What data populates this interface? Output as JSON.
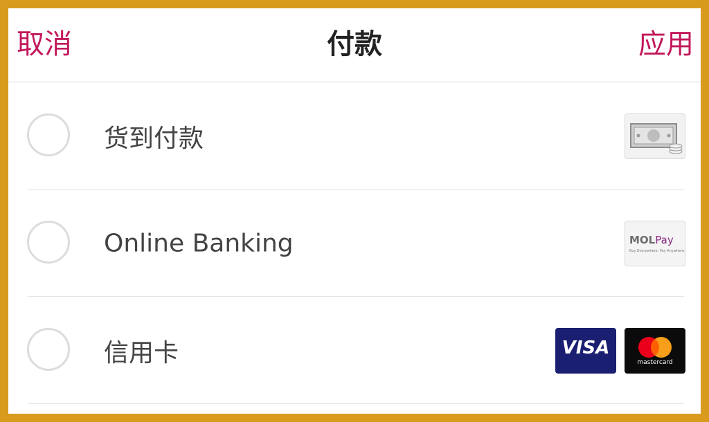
{
  "header": {
    "cancel_label": "取消",
    "title": "付款",
    "apply_label": "应用"
  },
  "payment_options": [
    {
      "label": "货到付款",
      "icon": "cash-icon",
      "selected": false
    },
    {
      "label": "Online Banking",
      "icon": "molpay-logo",
      "selected": false
    },
    {
      "label": "信用卡",
      "icon": [
        "visa-logo",
        "mastercard-logo"
      ],
      "selected": false
    }
  ],
  "logos": {
    "molpay_brand_mol": "MOL",
    "molpay_brand_pay": "Pay",
    "molpay_tagline": "Buy Everywhere. Pay Anywhere.",
    "visa_text": "VISA",
    "mastercard_text": "mastercard"
  },
  "colors": {
    "accent": "#C2185B",
    "frame": "#D99B1E",
    "visa_blue": "#1A1F71",
    "mastercard_red": "#EB001B",
    "mastercard_orange": "#F79E1B"
  }
}
